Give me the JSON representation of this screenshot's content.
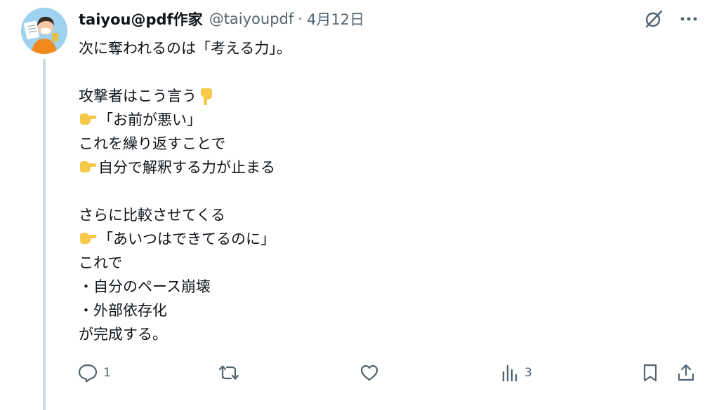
{
  "author": {
    "name": "taiyou@pdf作家",
    "handle": "@taiyoupdf",
    "separator": "·",
    "date": "4月12日"
  },
  "icons": {
    "avatar": "avatar",
    "grok": "grok-icon",
    "more": "more-icon",
    "reply": "reply-icon",
    "retweet": "retweet-icon",
    "like": "like-icon",
    "views": "views-icon",
    "bookmark": "bookmark-icon",
    "share": "share-icon",
    "emoji_down": "point-down-emoji",
    "emoji_right": "point-right-emoji"
  },
  "tweet": {
    "lines": [
      "次に奪われるのは「考える力」。",
      "",
      "攻撃者はこう言う",
      "「お前が悪い」",
      "これを繰り返すことで",
      "自分で解釈する力が止まる",
      "",
      "さらに比較させてくる",
      "「あいつはできてるのに」",
      "これで",
      "・自分のペース崩壊",
      "・外部依存化",
      "が完成する。"
    ]
  },
  "actions": {
    "reply_count": "1",
    "retweet_count": "",
    "like_count": "",
    "views_count": "3"
  },
  "colors": {
    "text": "#0f1419",
    "muted": "#536471",
    "thread_line": "#cfd9de",
    "emoji": "#f7c948"
  }
}
